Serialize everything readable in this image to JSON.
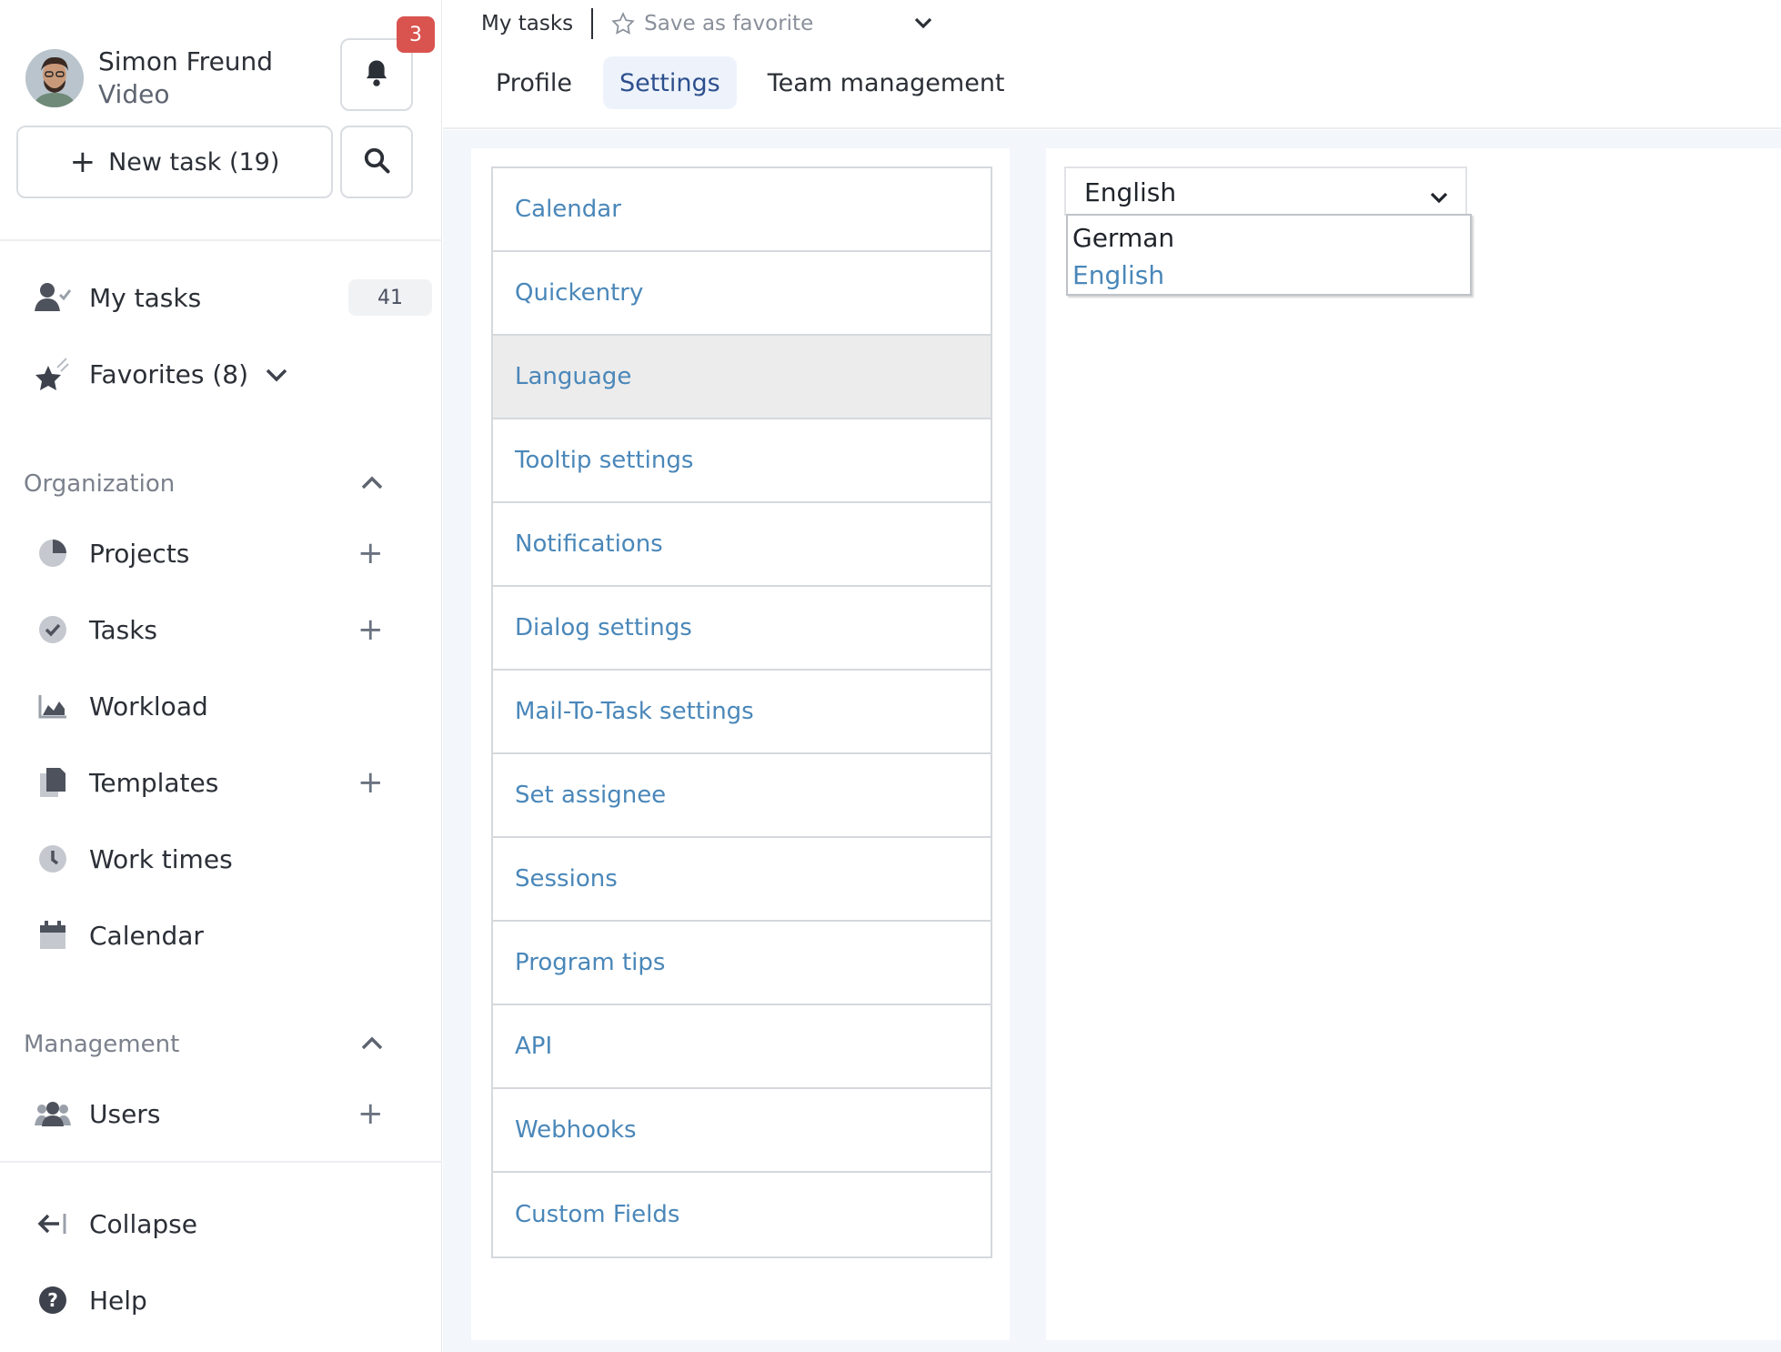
{
  "user": {
    "name": "Simon Freund",
    "subtitle": "Video"
  },
  "notifications": {
    "count": "3"
  },
  "new_task": {
    "label": "New task (19)"
  },
  "nav_top": [
    {
      "label": "My tasks",
      "count": "41",
      "icon": "user-check-icon"
    },
    {
      "label": "Favorites (8)",
      "icon": "star-icon"
    }
  ],
  "organization": {
    "title": "Organization",
    "items": [
      {
        "label": "Projects",
        "icon": "pie-chart-icon",
        "addable": true
      },
      {
        "label": "Tasks",
        "icon": "check-circle-icon",
        "addable": true
      },
      {
        "label": "Workload",
        "icon": "area-chart-icon",
        "addable": false
      },
      {
        "label": "Templates",
        "icon": "documents-icon",
        "addable": true
      },
      {
        "label": "Work times",
        "icon": "clock-icon",
        "addable": false
      },
      {
        "label": "Calendar",
        "icon": "calendar-icon",
        "addable": false
      }
    ]
  },
  "management": {
    "title": "Management",
    "items": [
      {
        "label": "Users",
        "icon": "users-icon",
        "addable": true
      }
    ]
  },
  "footer": {
    "collapse": "Collapse",
    "help": "Help"
  },
  "topbar": {
    "breadcrumb": "My tasks",
    "favorite": "Save as favorite"
  },
  "tabs": [
    {
      "label": "Profile",
      "active": false
    },
    {
      "label": "Settings",
      "active": true
    },
    {
      "label": "Team management",
      "active": false
    }
  ],
  "settings_menu": [
    "Calendar",
    "Quickentry",
    "Language",
    "Tooltip settings",
    "Notifications",
    "Dialog settings",
    "Mail-To-Task settings",
    "Set assignee",
    "Sessions",
    "Program tips",
    "API",
    "Webhooks",
    "Custom Fields"
  ],
  "settings_active": "Language",
  "language": {
    "selected": "English",
    "options": [
      "German",
      "English"
    ]
  },
  "colors": {
    "accent_link": "#4a87b9",
    "badge_red": "#d9534f",
    "active_tab_bg": "#eef3fb",
    "content_bg": "#f3f6fb"
  }
}
